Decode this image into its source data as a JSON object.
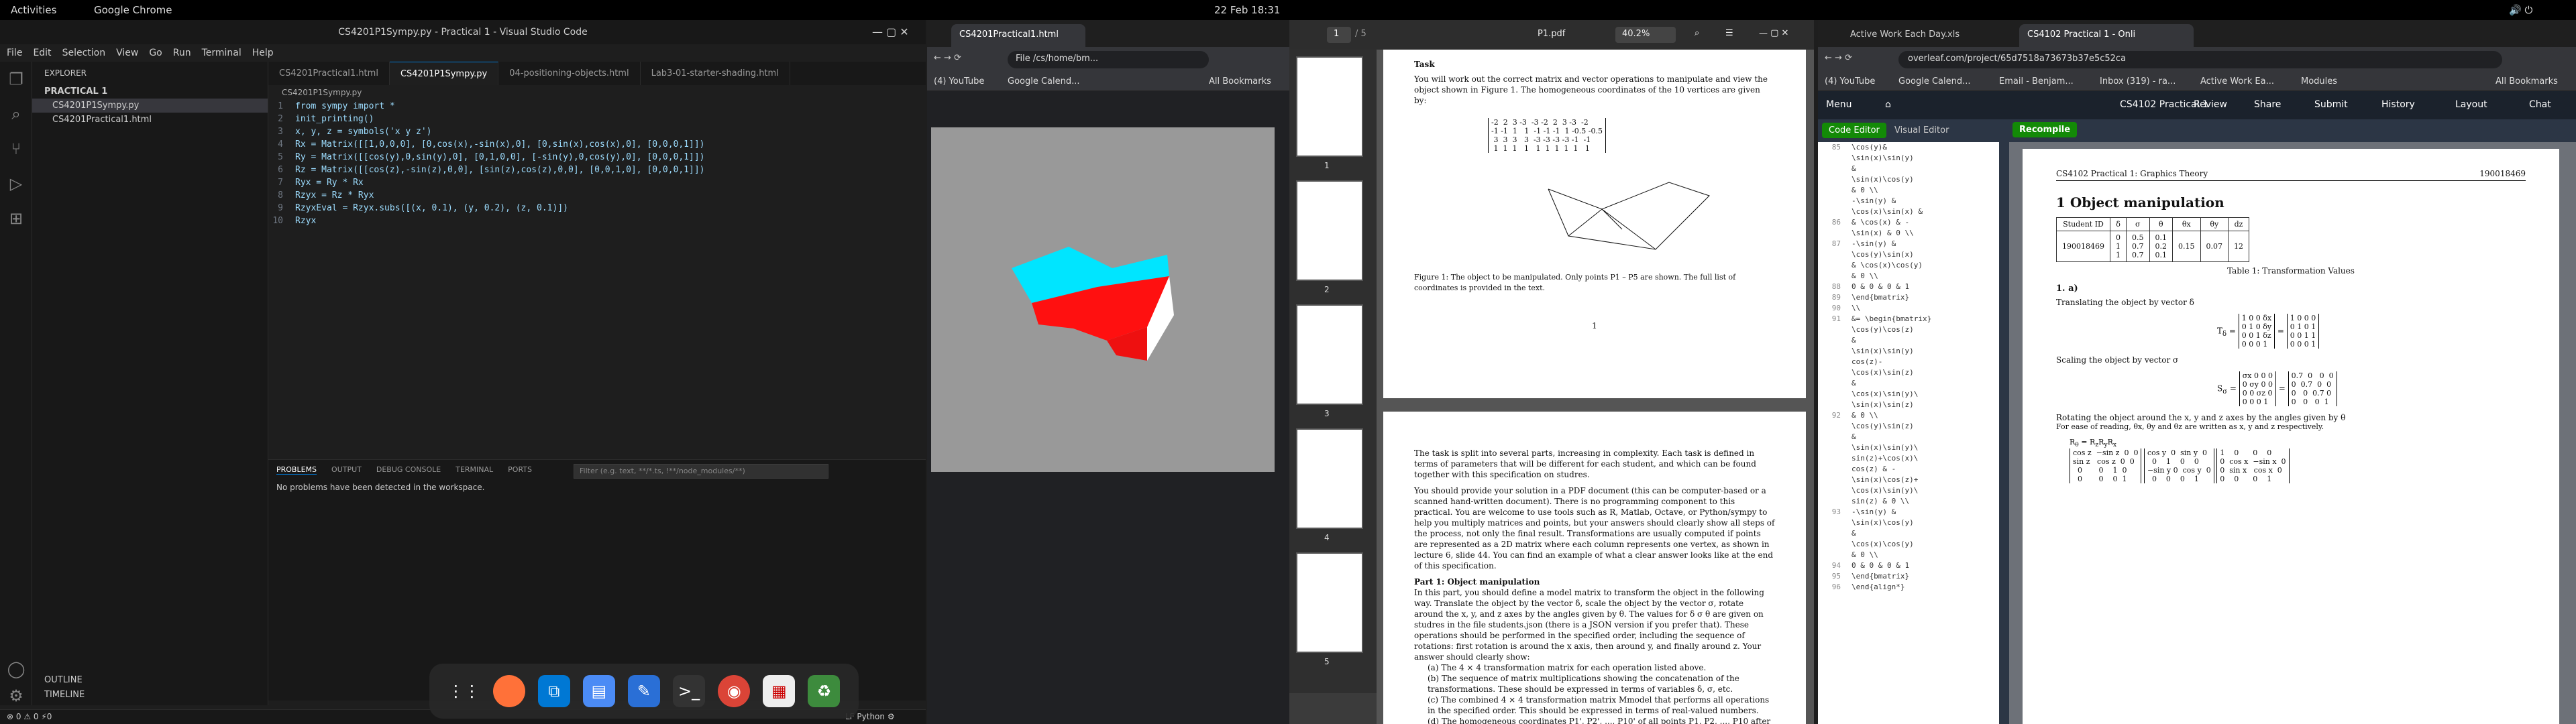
{
  "topbar": {
    "activities": "Activities",
    "app": "Google Chrome",
    "clock": "22 Feb 18:31"
  },
  "vscode": {
    "title": "CS4201P1Sympy.py - Practical 1 - Visual Studio Code",
    "menu": [
      "File",
      "Edit",
      "Selection",
      "View",
      "Go",
      "Run",
      "Terminal",
      "Help"
    ],
    "explorer": "EXPLORER",
    "project": "PRACTICAL 1",
    "files": [
      "CS4201P1Sympy.py",
      "CS4201Practical1.html"
    ],
    "tabs": [
      "CS4201Practical1.html",
      "CS4201P1Sympy.py",
      "04-positioning-objects.html",
      "Lab3-01-starter-shading.html"
    ],
    "breadcrumb": "CS4201P1Sympy.py",
    "code": [
      "from sympy import *",
      "init_printing()",
      "x, y, z = symbols('x y z')",
      "Rx = Matrix([[1,0,0,0], [0,cos(x),-sin(x),0], [0,sin(x),cos(x),0], [0,0,0,1]])",
      "Ry = Matrix([[cos(y),0,sin(y),0], [0,1,0,0], [-sin(y),0,cos(y),0], [0,0,0,1]])",
      "Rz = Matrix([[cos(z),-sin(z),0,0], [sin(z),cos(z),0,0], [0,0,1,0], [0,0,0,1]])",
      "Ryx = Ry * Rx",
      "Rzyx = Rz * Ryx",
      "RzyxEval = Rzyx.subs([(x, 0.1), (y, 0.2), (z, 0.1)])",
      "Rzyx"
    ],
    "panel_tabs": [
      "PROBLEMS",
      "OUTPUT",
      "DEBUG CONSOLE",
      "TERMINAL",
      "PORTS"
    ],
    "filter_placeholder": "Filter (e.g. text, **/*.ts, !**/node_modules/**)",
    "problems": "No problems have been detected in the workspace.",
    "outline": "OUTLINE",
    "timeline": "TIMELINE",
    "status_left": "⊗ 0 ⚠ 0  ⚡0",
    "status_right": "LF  Python  ⚙"
  },
  "chrome_viewer": {
    "tab": "CS4201Practical1.html",
    "url": "/cs/home/bm...",
    "file_chip": "File",
    "bookmarks": [
      "(4) YouTube",
      "Google Calend..."
    ],
    "all_bookmarks": "All Bookmarks"
  },
  "pdf": {
    "page": "1",
    "pages": "/ 5",
    "title": "P1.pdf",
    "zoom": "40.2%",
    "thumbs": [
      "1",
      "2",
      "3",
      "4",
      "5"
    ],
    "p1_heading": "Task",
    "p1_intro": "You will work out the correct matrix and vector operations to manipulate and view the object shown in Figure 1. The homogeneous coordinates of the 10 vertices are given by:",
    "p1_caption": "Figure 1: The object to be manipulated. Only points P1 – P5 are shown. The full list of coordinates is provided in the text.",
    "p1_num": "1",
    "p2_intro": "The task is split into several parts, increasing in complexity. Each task is defined in terms of parameters that will be different for each student, and which can be found together with this specification on studres.",
    "p2_body": "You should provide your solution in a PDF document (this can be computer-based or a scanned hand-written document). There is no programming component to this practical. You are welcome to use tools such as R, Matlab, Octave, or Python/sympy to help you multiply matrices and points, but your answers should clearly show all steps of the process, not only the final result. Transformations are usually computed if points are represented as a 2D matrix where each column represents one vertex, as shown in lecture 6, slide 44. You can find an example of what a clear answer looks like at the end of this specification.",
    "p2_part": "Part 1: Object manipulation",
    "p2_part_text": "In this part, you should define a model matrix to transform the object in the following way. Translate the object by the vector δ, scale the object by the vector σ, rotate around the x, y, and z axes by the angles given by θ. The values for δ σ θ are given on studres in the file students.json (there is a JSON version if you prefer that). These operations should be performed in the specified order, including the sequence of rotations: first rotation is around the x axis, then around y, and finally around z. Your answer should clearly show:",
    "p2_items": [
      "(a)  The 4 × 4 transformation matrix for each operation listed above.",
      "(b)  The sequence of matrix multiplications showing the concatenation of the transformations. These should be expressed in terms of variables δ, σ, etc.",
      "(c)  The combined 4 × 4 transformation matrix Mmodel that performs all operations in the specified order. This should be expressed in terms of real-valued numbers.",
      "(d)  The homogeneous coordinates P1', P2', ..., P10' of all points P1, P2, ..., P10 after the combined transformation."
    ]
  },
  "overleaf": {
    "tabs": [
      "Active Work Each Day.xls",
      "CS4102 Practical 1 - Onli"
    ],
    "url": "overleaf.com/project/65d7518a73673b37e5c52ca",
    "bookmarks": [
      "(4) YouTube",
      "Google Calend...",
      "Email - Benjam...",
      "Inbox (319) - ra...",
      "Active Work Ea...",
      "Modules"
    ],
    "all_bookmarks": "All Bookmarks",
    "menu": "Menu",
    "project": "CS4102 Practical 1",
    "actions": [
      "Review",
      "Share",
      "Submit",
      "History",
      "Layout",
      "Chat"
    ],
    "code_editor": "Code Editor",
    "visual_editor": "Visual Editor",
    "recompile": "Recompile",
    "line_numbers": [
      "85",
      "",
      "",
      "",
      "",
      "",
      "",
      "86",
      "",
      "87",
      "",
      "",
      "",
      "88",
      "89",
      "90",
      "91",
      "",
      "",
      "",
      "",
      "",
      "",
      "",
      "",
      "92",
      "",
      "",
      "",
      "",
      "",
      "",
      "",
      "",
      "93",
      "",
      "",
      "",
      "",
      "94",
      "95",
      "96"
    ],
    "src": [
      "\\cos(y)&",
      "\\sin(x)\\sin(y)",
      "&",
      "\\sin(x)\\cos(y)",
      "& 0 \\\\",
      "-\\sin(y) &",
      "\\cos(x)\\sin(x) &",
      "& \\cos(x) & -",
      "\\sin(x) & 0 \\\\",
      "-\\sin(y) &",
      "\\cos(y)\\sin(x)",
      "& \\cos(x)\\cos(y)",
      "& 0 \\\\",
      "0 & 0 & 0 & 1",
      "\\end{bmatrix}",
      "\\\\",
      "&= \\begin{bmatrix}",
      "\\cos(y)\\cos(z)",
      "&",
      "\\sin(x)\\sin(y)",
      "cos(z)-",
      "\\cos(x)\\sin(z)",
      "&",
      "\\cos(x)\\sin(y)\\",
      "\\sin(x)\\sin(z)",
      "& 0 \\\\",
      "\\cos(y)\\sin(z)",
      "&",
      "\\sin(x)\\sin(y)\\",
      "sin(z)+\\cos(x)\\",
      "cos(z) & -",
      "\\sin(x)\\cos(z)+",
      "\\cos(x)\\sin(y)\\",
      "sin(z) & 0 \\\\",
      "-\\sin(y) &",
      "\\sin(x)\\cos(y)",
      "&",
      "\\cos(x)\\cos(y)",
      "& 0 \\\\",
      "0 & 0 & 0 & 1",
      "\\end{bmatrix}",
      "\\end{align*}"
    ],
    "doc": {
      "course": "CS4102 Practical 1: Graphics Theory",
      "id": "190018469",
      "section": "1   Object manipulation",
      "table_headers": [
        "Student ID",
        "δ",
        "σ",
        "θ",
        "θx",
        "θy",
        "dz"
      ],
      "table_row": [
        "190018469",
        "0\n1\n1",
        "0.5\n0.7\n0.7",
        "0.1\n0.2\n0.1",
        "0.15",
        "0.07",
        "12"
      ],
      "table_caption": "Table 1: Transformation Values",
      "sub": "1.  a)",
      "trans_heading": "Translating the object by vector δ",
      "scale_heading": "Scaling the object by vector σ",
      "rot_heading": "Rotating the object around the x, y and z axes by the angles given by θ",
      "rot_text": "For ease of reading, θx, θy and θz are written as x, y and z respectively."
    }
  },
  "colors": {
    "cube_top": "#00e5ff",
    "cube_side": "#ff1010",
    "cube_front": "#ffffff",
    "accent": "#0078d4",
    "overleaf_green": "#138a07"
  }
}
